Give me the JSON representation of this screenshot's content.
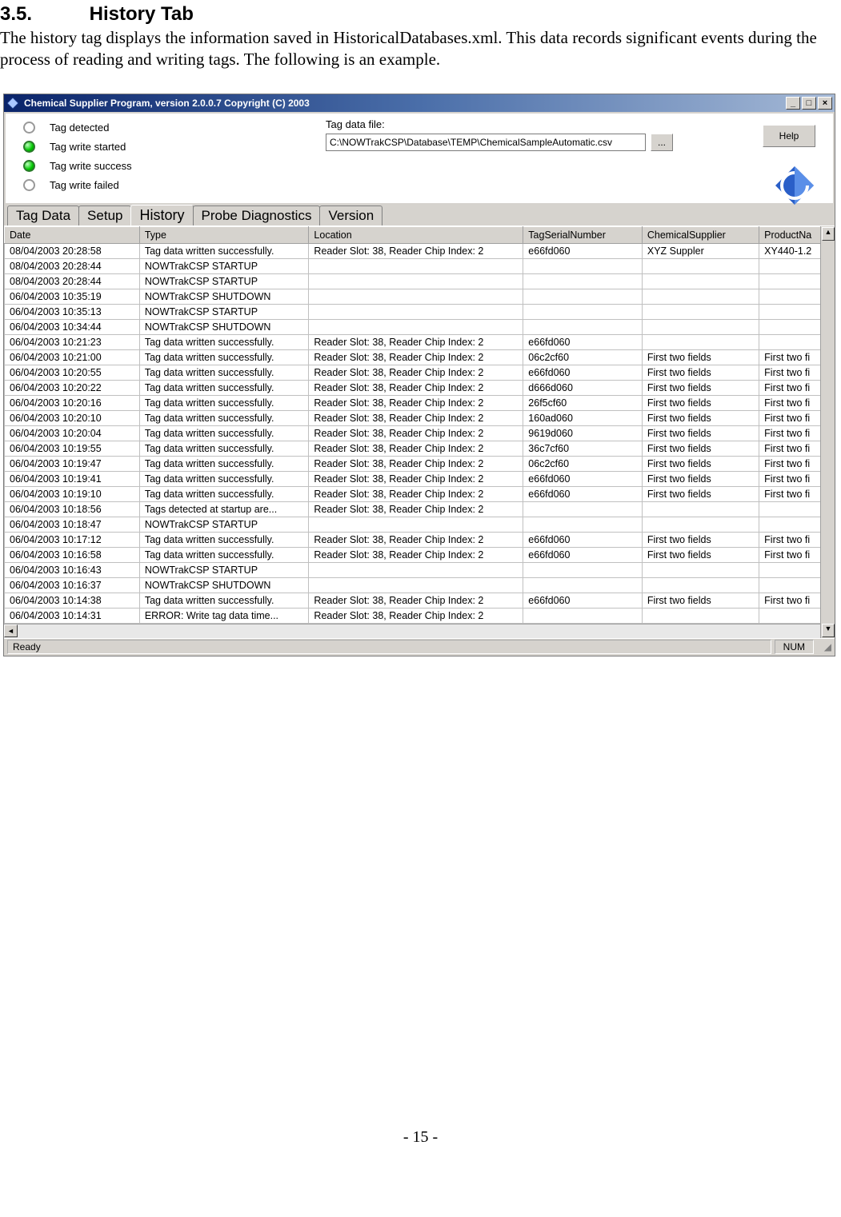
{
  "doc": {
    "section_number": "3.5.",
    "section_title": "History Tab",
    "body_text": "The history tag displays the information saved in HistoricalDatabases.xml. This data records significant events during the process of reading and writing tags. The following is an example.",
    "page_number": "- 15 -"
  },
  "app": {
    "window_title": "Chemical Supplier Program, version 2.0.0.7 Copyright (C) 2003",
    "status_leds": [
      {
        "label": "Tag detected",
        "on": false
      },
      {
        "label": "Tag write started",
        "on": true
      },
      {
        "label": "Tag write success",
        "on": true
      },
      {
        "label": "Tag write failed",
        "on": false
      }
    ],
    "file": {
      "label": "Tag data file:",
      "value": "C:\\NOWTrakCSP\\Database\\TEMP\\ChemicalSampleAutomatic.csv",
      "browse_label": "..."
    },
    "help_label": "Help",
    "tabs": [
      "Tag Data",
      "Setup",
      "History",
      "Probe Diagnostics",
      "Version"
    ],
    "active_tab_index": 2,
    "columns": [
      "Date",
      "Type",
      "Location",
      "TagSerialNumber",
      "ChemicalSupplier",
      "ProductNa"
    ],
    "rows": [
      {
        "date": "08/04/2003 20:28:58",
        "type": "Tag data written successfully.",
        "loc": "Reader Slot: 38, Reader Chip Index: 2",
        "tag": "e66fd060",
        "chem": "XYZ Suppler",
        "prod": "XY440-1.2"
      },
      {
        "date": "08/04/2003 20:28:44",
        "type": "NOWTrakCSP STARTUP",
        "loc": "",
        "tag": "",
        "chem": "",
        "prod": ""
      },
      {
        "date": "08/04/2003 20:28:44",
        "type": "NOWTrakCSP STARTUP",
        "loc": "",
        "tag": "",
        "chem": "",
        "prod": ""
      },
      {
        "date": "06/04/2003 10:35:19",
        "type": "NOWTrakCSP SHUTDOWN",
        "loc": "",
        "tag": "",
        "chem": "",
        "prod": ""
      },
      {
        "date": "06/04/2003 10:35:13",
        "type": "NOWTrakCSP STARTUP",
        "loc": "",
        "tag": "",
        "chem": "",
        "prod": ""
      },
      {
        "date": "06/04/2003 10:34:44",
        "type": "NOWTrakCSP SHUTDOWN",
        "loc": "",
        "tag": "",
        "chem": "",
        "prod": ""
      },
      {
        "date": "06/04/2003 10:21:23",
        "type": "Tag data written successfully.",
        "loc": "Reader Slot: 38, Reader Chip Index: 2",
        "tag": "e66fd060",
        "chem": "",
        "prod": ""
      },
      {
        "date": "06/04/2003 10:21:00",
        "type": "Tag data written successfully.",
        "loc": "Reader Slot: 38, Reader Chip Index: 2",
        "tag": "06c2cf60",
        "chem": "First two fields",
        "prod": "First two fi"
      },
      {
        "date": "06/04/2003 10:20:55",
        "type": "Tag data written successfully.",
        "loc": "Reader Slot: 38, Reader Chip Index: 2",
        "tag": "e66fd060",
        "chem": "First two fields",
        "prod": "First two fi"
      },
      {
        "date": "06/04/2003 10:20:22",
        "type": "Tag data written successfully.",
        "loc": "Reader Slot: 38, Reader Chip Index: 2",
        "tag": "d666d060",
        "chem": "First two fields",
        "prod": "First two fi"
      },
      {
        "date": "06/04/2003 10:20:16",
        "type": "Tag data written successfully.",
        "loc": "Reader Slot: 38, Reader Chip Index: 2",
        "tag": "26f5cf60",
        "chem": "First two fields",
        "prod": "First two fi"
      },
      {
        "date": "06/04/2003 10:20:10",
        "type": "Tag data written successfully.",
        "loc": "Reader Slot: 38, Reader Chip Index: 2",
        "tag": "160ad060",
        "chem": "First two fields",
        "prod": "First two fi"
      },
      {
        "date": "06/04/2003 10:20:04",
        "type": "Tag data written successfully.",
        "loc": "Reader Slot: 38, Reader Chip Index: 2",
        "tag": "9619d060",
        "chem": "First two fields",
        "prod": "First two fi"
      },
      {
        "date": "06/04/2003 10:19:55",
        "type": "Tag data written successfully.",
        "loc": "Reader Slot: 38, Reader Chip Index: 2",
        "tag": "36c7cf60",
        "chem": "First two fields",
        "prod": "First two fi"
      },
      {
        "date": "06/04/2003 10:19:47",
        "type": "Tag data written successfully.",
        "loc": "Reader Slot: 38, Reader Chip Index: 2",
        "tag": "06c2cf60",
        "chem": "First two fields",
        "prod": "First two fi"
      },
      {
        "date": "06/04/2003 10:19:41",
        "type": "Tag data written successfully.",
        "loc": "Reader Slot: 38, Reader Chip Index: 2",
        "tag": "e66fd060",
        "chem": "First two fields",
        "prod": "First two fi"
      },
      {
        "date": "06/04/2003 10:19:10",
        "type": "Tag data written successfully.",
        "loc": "Reader Slot: 38, Reader Chip Index: 2",
        "tag": "e66fd060",
        "chem": "First two fields",
        "prod": "First two fi"
      },
      {
        "date": "06/04/2003 10:18:56",
        "type": "Tags detected at startup are...",
        "loc": "Reader Slot: 38, Reader Chip Index: 2",
        "tag": "",
        "chem": "",
        "prod": ""
      },
      {
        "date": "06/04/2003 10:18:47",
        "type": "NOWTrakCSP STARTUP",
        "loc": "",
        "tag": "",
        "chem": "",
        "prod": ""
      },
      {
        "date": "06/04/2003 10:17:12",
        "type": "Tag data written successfully.",
        "loc": "Reader Slot: 38, Reader Chip Index: 2",
        "tag": "e66fd060",
        "chem": "First two fields",
        "prod": "First two fi"
      },
      {
        "date": "06/04/2003 10:16:58",
        "type": "Tag data written successfully.",
        "loc": "Reader Slot: 38, Reader Chip Index: 2",
        "tag": "e66fd060",
        "chem": "First two fields",
        "prod": "First two fi"
      },
      {
        "date": "06/04/2003 10:16:43",
        "type": "NOWTrakCSP STARTUP",
        "loc": "",
        "tag": "",
        "chem": "",
        "prod": ""
      },
      {
        "date": "06/04/2003 10:16:37",
        "type": "NOWTrakCSP SHUTDOWN",
        "loc": "",
        "tag": "",
        "chem": "",
        "prod": ""
      },
      {
        "date": "06/04/2003 10:14:38",
        "type": "Tag data written successfully.",
        "loc": "Reader Slot: 38, Reader Chip Index: 2",
        "tag": "e66fd060",
        "chem": "First two fields",
        "prod": "First two fi"
      },
      {
        "date": "06/04/2003 10:14:31",
        "type": "ERROR: Write tag data time...",
        "loc": "Reader Slot: 38, Reader Chip Index: 2",
        "tag": "",
        "chem": "",
        "prod": ""
      }
    ],
    "statusbar": {
      "left": "Ready",
      "num": "NUM"
    }
  }
}
